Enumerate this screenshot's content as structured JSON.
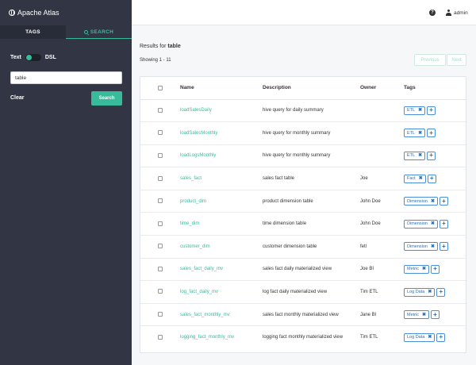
{
  "app": {
    "title": "Apache Atlas"
  },
  "sidebar": {
    "tabs": {
      "tags": "TAGS",
      "search": "SEARCH"
    },
    "toggle": {
      "left_label": "Text",
      "right_label": "DSL"
    },
    "search_value": "table",
    "clear_label": "Clear",
    "search_button": "Search"
  },
  "header": {
    "help": "?",
    "user": "admin"
  },
  "main": {
    "results_prefix": "Results for ",
    "query": "table",
    "showing": "Showing 1 - 11",
    "previous": "Previous",
    "next": "Next",
    "columns": {
      "name": "Name",
      "description": "Description",
      "owner": "Owner",
      "tags": "Tags"
    },
    "rows": [
      {
        "name": "loadSalesDaily",
        "description": "hive query for daily summary",
        "owner": "",
        "tag": "ETL"
      },
      {
        "name": "loadSalesMonthly",
        "description": "hive query for monthly summary",
        "owner": "",
        "tag": "ETL"
      },
      {
        "name": "loadLogsMonthly",
        "description": "hive query for monthly summary",
        "owner": "",
        "tag": "ETL"
      },
      {
        "name": "sales_fact",
        "description": "sales fact table",
        "owner": "Joe",
        "tag": "Fact"
      },
      {
        "name": "product_dim",
        "description": "product dimension table",
        "owner": "John Doe",
        "tag": "Dimension"
      },
      {
        "name": "time_dim",
        "description": "time dimension table",
        "owner": "John Doe",
        "tag": "Dimension"
      },
      {
        "name": "customer_dim",
        "description": "customer dimension table",
        "owner": "fetl",
        "tag": "Dimension"
      },
      {
        "name": "sales_fact_daily_mv",
        "description": "sales fact daily materialized view",
        "owner": "Joe BI",
        "tag": "Metric"
      },
      {
        "name": "log_fact_daily_mv",
        "description": "log fact daily materialized view",
        "owner": "Tim ETL",
        "tag": "Log Data"
      },
      {
        "name": "sales_fact_monthly_mv",
        "description": "sales fact monthly materialized view",
        "owner": "Jane BI",
        "tag": "Metric"
      },
      {
        "name": "logging_fact_monthly_mv",
        "description": "logging fact monthly materialized view",
        "owner": "Tim ETL",
        "tag": "Log Data"
      }
    ]
  },
  "icons": {
    "brand": "globe-icon",
    "search_tab": "search-icon",
    "help": "question-circle-icon",
    "user": "user-icon",
    "remove_tag": "times-icon",
    "add_tag": "plus-icon"
  },
  "colors": {
    "sidebar": "#323544",
    "accent": "#38bb9b",
    "tag_border": "#4a90d9"
  }
}
